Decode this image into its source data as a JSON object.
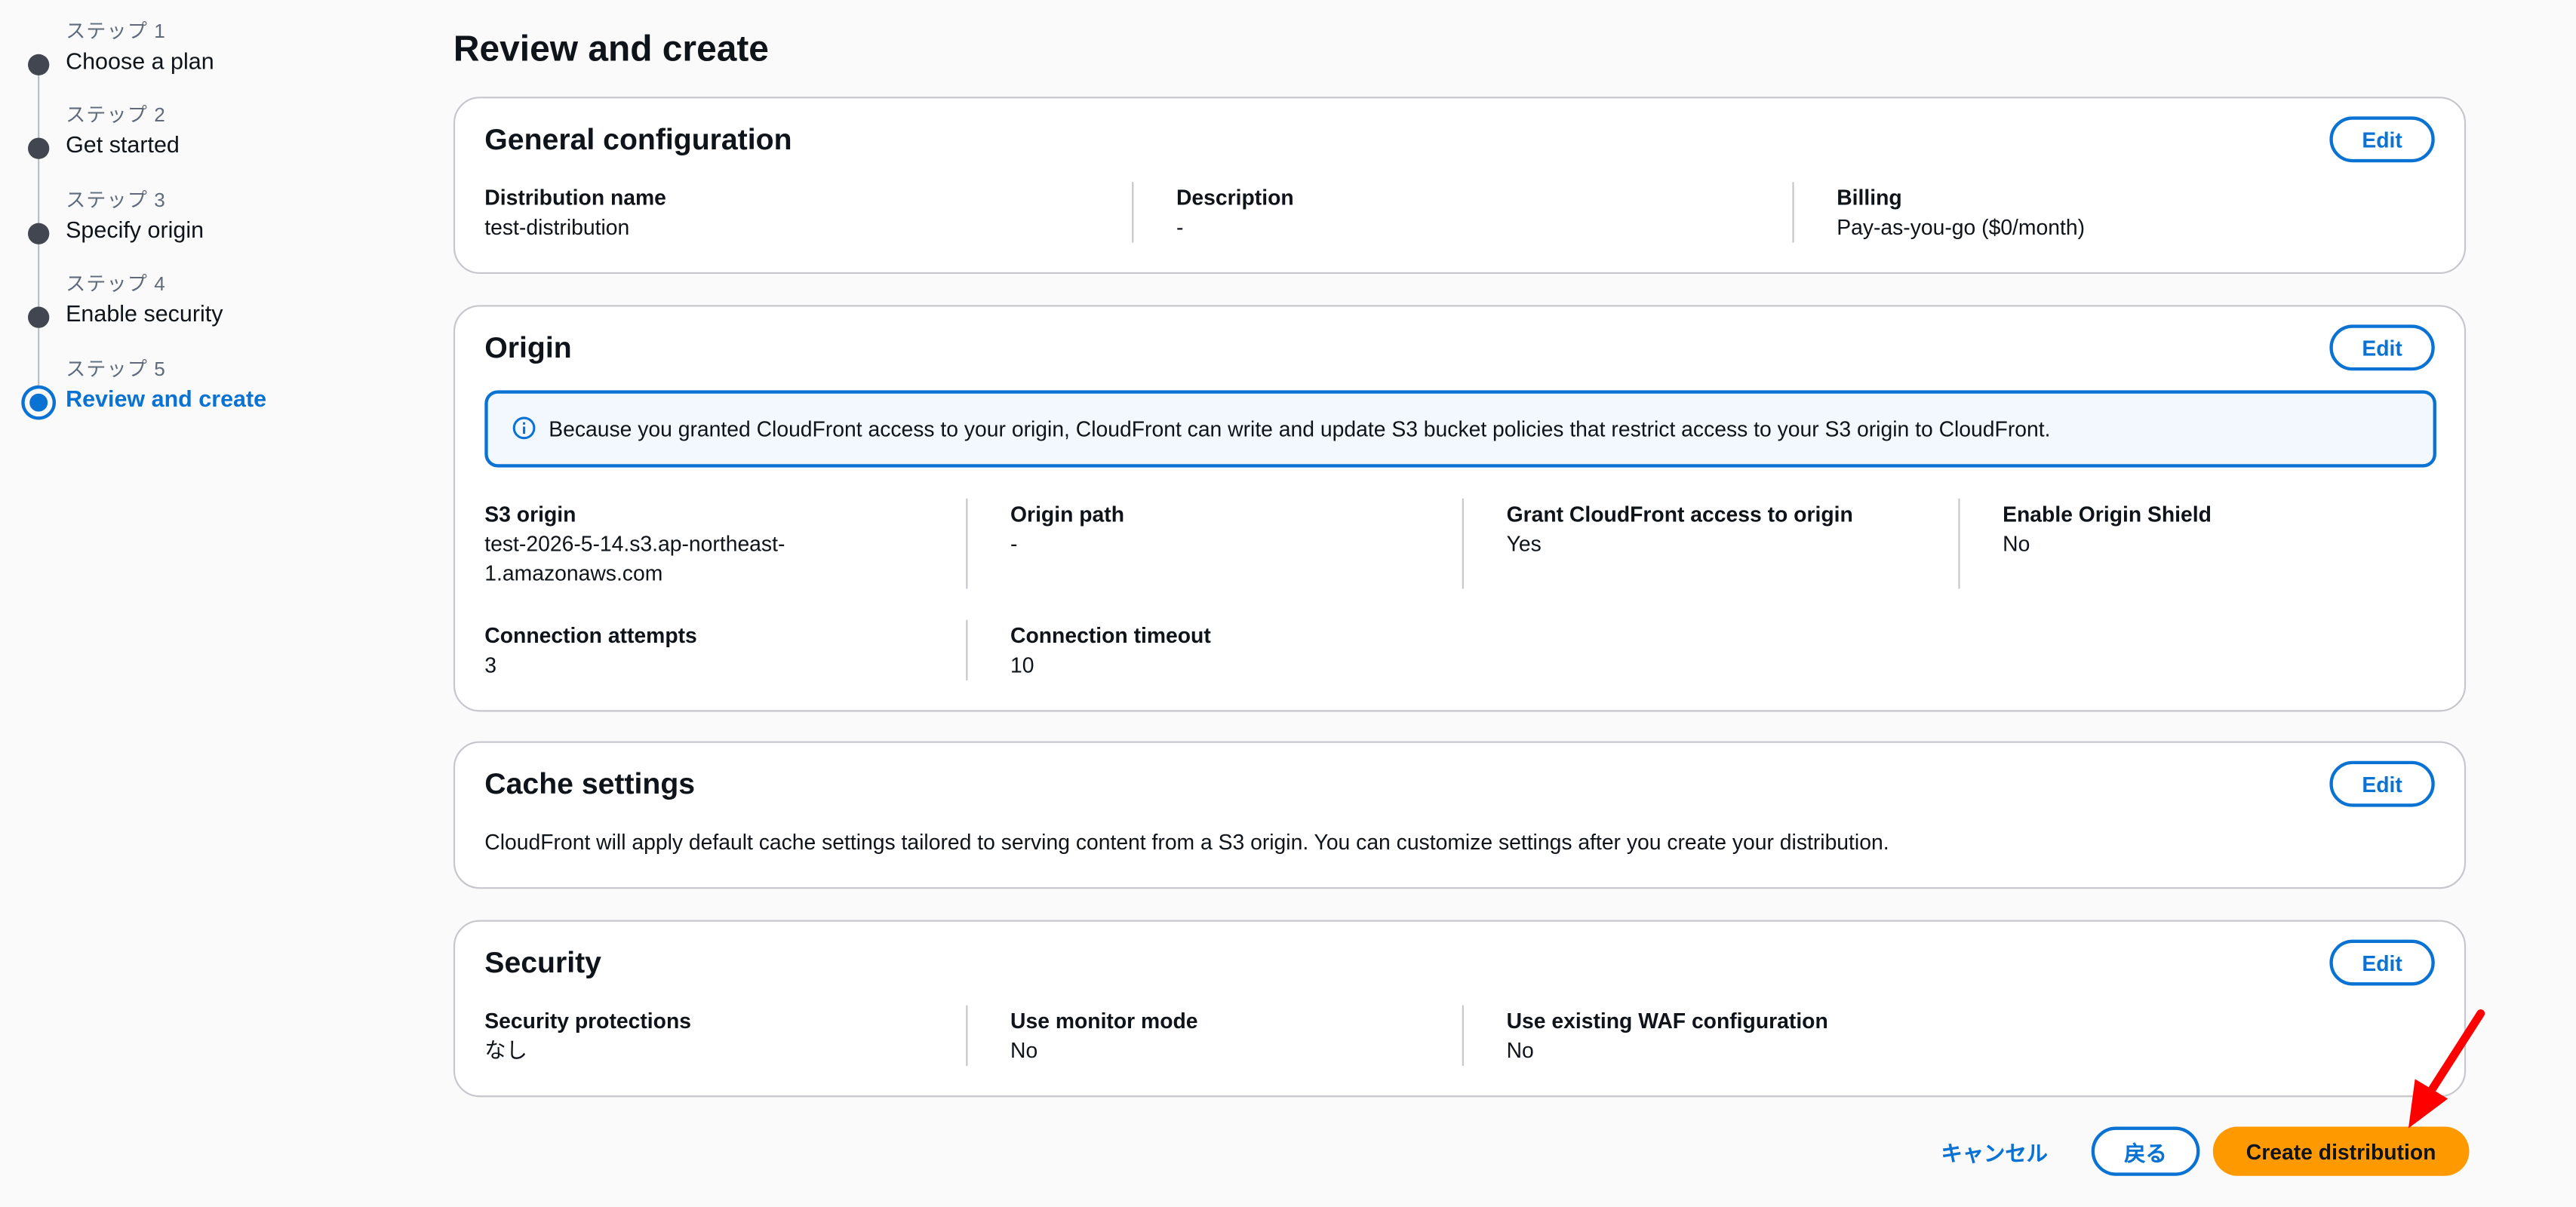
{
  "stepper": {
    "steps": [
      {
        "num": "ステップ 1",
        "label": "Choose a plan"
      },
      {
        "num": "ステップ 2",
        "label": "Get started"
      },
      {
        "num": "ステップ 3",
        "label": "Specify origin"
      },
      {
        "num": "ステップ 4",
        "label": "Enable security"
      },
      {
        "num": "ステップ 5",
        "label": "Review and create"
      }
    ]
  },
  "page_title": "Review and create",
  "general": {
    "title": "General configuration",
    "edit_label": "Edit",
    "fields": [
      {
        "label": "Distribution name",
        "value": "test-distribution"
      },
      {
        "label": "Description",
        "value": "-"
      },
      {
        "label": "Billing",
        "value": "Pay-as-you-go ($0/month)"
      }
    ]
  },
  "origin": {
    "title": "Origin",
    "edit_label": "Edit",
    "info": "Because you granted CloudFront access to your origin, CloudFront can write and update S3 bucket policies that restrict access to your S3 origin to CloudFront.",
    "fields": [
      {
        "label": "S3 origin",
        "value": "test-2026-5-14.s3.ap-northeast-\n1.amazonaws.com"
      },
      {
        "label": "Origin path",
        "value": "-"
      },
      {
        "label": "Grant CloudFront access to origin",
        "value": "Yes"
      },
      {
        "label": "Enable Origin Shield",
        "value": "No"
      },
      {
        "label": "Connection attempts",
        "value": "3"
      },
      {
        "label": "Connection timeout",
        "value": "10"
      }
    ]
  },
  "cache": {
    "title": "Cache settings",
    "edit_label": "Edit",
    "text": "CloudFront will apply default cache settings tailored to serving content from a S3 origin. You can customize settings after you create your distribution."
  },
  "security": {
    "title": "Security",
    "edit_label": "Edit",
    "fields": [
      {
        "label": "Security protections",
        "value": "なし"
      },
      {
        "label": "Use monitor mode",
        "value": "No"
      },
      {
        "label": "Use existing WAF configuration",
        "value": "No"
      }
    ]
  },
  "footer": {
    "cancel_label": "キャンセル",
    "back_label": "戻る",
    "create_label": "Create distribution"
  },
  "colors": {
    "accent": "#0972d3",
    "primary_button": "#ff9900",
    "annotation_arrow": "#ff0000"
  },
  "icons": {
    "info": "info-icon",
    "annotation": "red-arrow-icon"
  }
}
